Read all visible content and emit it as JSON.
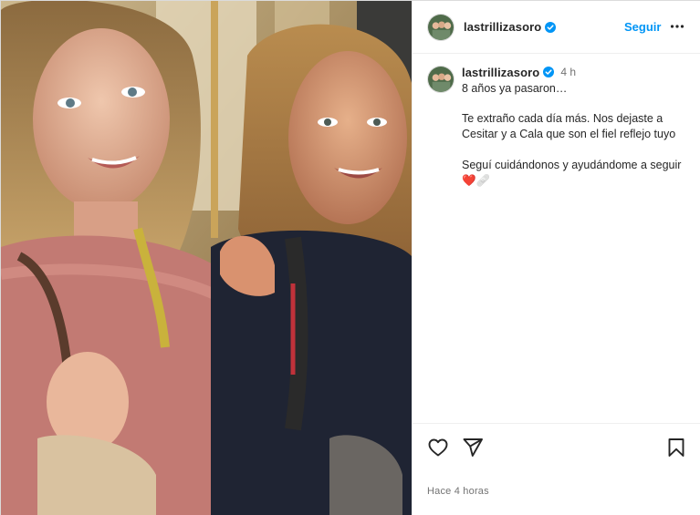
{
  "post": {
    "username": "lastrillizasoro",
    "follow_label": "Seguir",
    "caption_time": "4 h",
    "caption_line1": "8 años ya pasaron…",
    "caption_line2": "Te extraño cada día más. Nos dejaste a Cesitar y a Cala que son el fiel reflejo tuyo",
    "caption_line3": "Seguí cuidándonos y ayudándome a seguir",
    "caption_emoji_heart": "❤️",
    "caption_emoji_bandage": "🩹",
    "posted_ago": "Hace 4 horas"
  },
  "icons": {
    "verified": "verified-badge-icon",
    "more": "more-options-icon",
    "like": "heart-icon",
    "share": "share-paper-plane-icon",
    "save": "bookmark-icon"
  },
  "colors": {
    "accent": "#0095f6",
    "text": "#262626",
    "muted": "#737373",
    "border": "#dbdbdb"
  }
}
